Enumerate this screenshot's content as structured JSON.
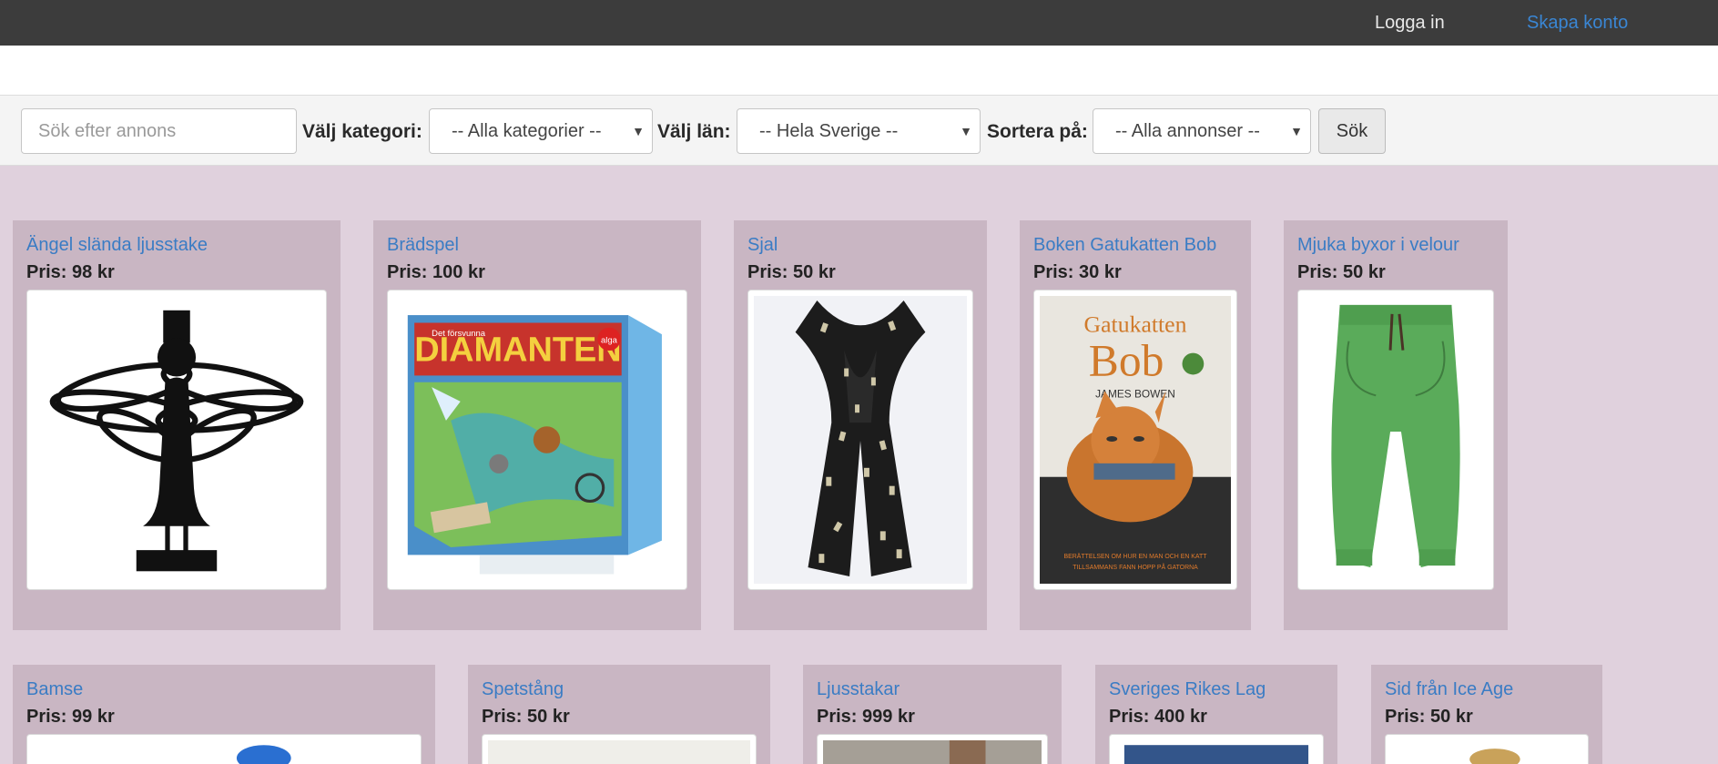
{
  "nav": {
    "login": "Logga in",
    "register": "Skapa konto"
  },
  "search": {
    "placeholder": "Sök efter annons",
    "category_label": "Välj kategori:",
    "category_value": "-- Alla kategorier --",
    "county_label": "Välj län:",
    "county_value": "-- Hela Sverige --",
    "sort_label": "Sortera på:",
    "sort_value": "-- Alla annonser --",
    "button": "Sök"
  },
  "listings": [
    {
      "title": "Ängel slända ljusstake",
      "price": "Pris: 98 kr",
      "image": "angel-candlestick"
    },
    {
      "title": "Brädspel",
      "price": "Pris: 100 kr",
      "image": "board-game-diamanten"
    },
    {
      "title": "Sjal",
      "price": "Pris: 50 kr",
      "image": "scarf"
    },
    {
      "title": "Boken Gatukatten Bob",
      "price": "Pris: 30 kr",
      "image": "book-cover-cat"
    },
    {
      "title": "Mjuka byxor i velour",
      "price": "Pris: 50 kr",
      "image": "green-pants"
    },
    {
      "title": "Bamse",
      "price": "Pris: 99 kr",
      "image": "bamse"
    },
    {
      "title": "Spetstång",
      "price": "Pris: 50 kr",
      "image": "pliers"
    },
    {
      "title": "Ljusstakar",
      "price": "Pris: 999 kr",
      "image": "candlesticks"
    },
    {
      "title": "Sveriges Rikes Lag",
      "price": "Pris: 400 kr",
      "image": "law-book"
    },
    {
      "title": "Sid från Ice Age",
      "price": "Pris: 50 kr",
      "image": "sid-toy"
    }
  ],
  "images": {
    "board_game": {
      "brand": "alga",
      "small_text": "Det försvunna",
      "title": "DIAMANTEN"
    },
    "book": {
      "title_line1": "Gatukatten",
      "title_line2": "Bob",
      "author": "JAMES BOWEN",
      "tagline_1": "BERÄTTELSEN OM HUR EN MAN OCH EN KATT",
      "tagline_2": "TILLSAMMANS FANN HOPP PÅ GATORNA"
    }
  }
}
